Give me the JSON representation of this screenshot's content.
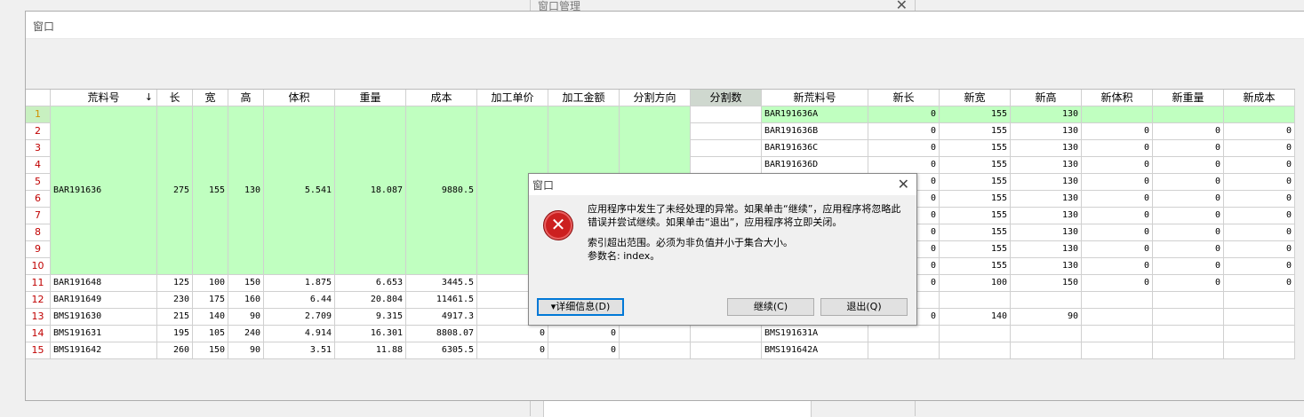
{
  "background_window": {
    "title": "窗口管理",
    "close": "✕"
  },
  "main_window": {
    "title": "窗口"
  },
  "grid": {
    "columns": [
      "",
      "荒料号",
      "长",
      "宽",
      "高",
      "体积",
      "重量",
      "成本",
      "加工单价",
      "加工金额",
      "分割方向",
      "分割数",
      "新荒料号",
      "新长",
      "新宽",
      "新高",
      "新体积",
      "新重量",
      "新成本"
    ],
    "sort_indicator": "↓",
    "merged_block": {
      "code": "BAR191636",
      "length": "275",
      "width": "155",
      "height": "130",
      "volume": "5.541",
      "weight": "18.087",
      "cost": "9880.5"
    },
    "rows": [
      [
        "1",
        "",
        "",
        "",
        "",
        "",
        "",
        "",
        "",
        "",
        "",
        "",
        "BAR191636A",
        "0",
        "155",
        "130",
        "",
        "",
        ""
      ],
      [
        "2",
        "",
        "",
        "",
        "",
        "",
        "",
        "",
        "",
        "",
        "",
        "",
        "BAR191636B",
        "0",
        "155",
        "130",
        "0",
        "0",
        "0"
      ],
      [
        "3",
        "",
        "",
        "",
        "",
        "",
        "",
        "",
        "",
        "",
        "",
        "",
        "BAR191636C",
        "0",
        "155",
        "130",
        "0",
        "0",
        "0"
      ],
      [
        "4",
        "",
        "",
        "",
        "",
        "",
        "",
        "",
        "",
        "",
        "",
        "",
        "BAR191636D",
        "0",
        "155",
        "130",
        "0",
        "0",
        "0"
      ],
      [
        "5",
        "",
        "",
        "",
        "",
        "",
        "",
        "",
        "",
        "",
        "",
        "",
        "",
        "0",
        "155",
        "130",
        "0",
        "0",
        "0"
      ],
      [
        "6",
        "",
        "",
        "",
        "",
        "",
        "",
        "",
        "",
        "",
        "",
        "",
        "",
        "0",
        "155",
        "130",
        "0",
        "0",
        "0"
      ],
      [
        "7",
        "",
        "",
        "",
        "",
        "",
        "",
        "",
        "",
        "",
        "",
        "",
        "",
        "0",
        "155",
        "130",
        "0",
        "0",
        "0"
      ],
      [
        "8",
        "",
        "",
        "",
        "",
        "",
        "",
        "",
        "",
        "",
        "",
        "",
        "",
        "0",
        "155",
        "130",
        "0",
        "0",
        "0"
      ],
      [
        "9",
        "",
        "",
        "",
        "",
        "",
        "",
        "",
        "",
        "",
        "",
        "",
        "",
        "0",
        "155",
        "130",
        "0",
        "0",
        "0"
      ],
      [
        "10",
        "",
        "",
        "",
        "",
        "",
        "",
        "",
        "",
        "",
        "",
        "",
        "",
        "0",
        "155",
        "130",
        "0",
        "0",
        "0"
      ],
      [
        "11",
        "BAR191648",
        "125",
        "100",
        "150",
        "1.875",
        "6.653",
        "3445.5",
        "",
        "",
        "",
        "",
        "",
        "0",
        "100",
        "150",
        "0",
        "0",
        "0"
      ],
      [
        "12",
        "BAR191649",
        "230",
        "175",
        "160",
        "6.44",
        "20.804",
        "11461.5",
        "",
        "",
        "",
        "",
        "",
        "",
        "",
        "",
        "",
        "",
        ""
      ],
      [
        "13",
        "BMS191630",
        "215",
        "140",
        "90",
        "2.709",
        "9.315",
        "4917.3",
        "",
        "",
        "",
        "",
        "",
        "0",
        "140",
        "90",
        "",
        "",
        ""
      ],
      [
        "14",
        "BMS191631",
        "195",
        "105",
        "240",
        "4.914",
        "16.301",
        "8808.07",
        "0",
        "0",
        "",
        "",
        "BMS191631A",
        "",
        "",
        "",
        "",
        "",
        ""
      ],
      [
        "15",
        "BMS191642",
        "260",
        "150",
        "90",
        "3.51",
        "11.88",
        "6305.5",
        "0",
        "0",
        "",
        "",
        "BMS191642A",
        "",
        "",
        "",
        "",
        "",
        ""
      ]
    ]
  },
  "dialog": {
    "title": "窗口",
    "close": "✕",
    "icon": "error-icon",
    "message": "应用程序中发生了未经处理的异常。如果单击“继续”，应用程序将忽略此错误并尝试继续。如果单击“退出”，应用程序将立即关闭。",
    "detail_line1": "索引超出范围。必须为非负值并小于集合大小。",
    "detail_line2": "参数名: index。",
    "details_button": "详细信息(D)",
    "continue_button": "继续(C)",
    "quit_button": "退出(Q)",
    "colors": {
      "error": "#cc2020",
      "focus": "#0078d7"
    }
  }
}
